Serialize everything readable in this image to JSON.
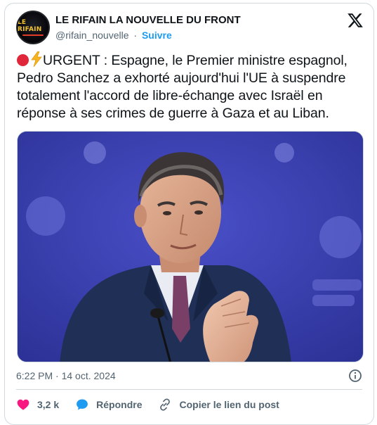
{
  "account": {
    "display_name": "LE RIFAIN LA NOUVELLE DU FRONT",
    "handle": "@rifain_nouvelle",
    "separator": "·",
    "follow_label": "Suivre",
    "avatar_text": "LE RIFAIN"
  },
  "tweet": {
    "text": "URGENT : Espagne, le Premier ministre espagnol, Pedro Sanchez a exhorté aujourd'hui l'UE à suspendre totalement l'accord de libre-échange avec Israël en réponse à ses crimes de guerre à Gaza et au Liban.",
    "timestamp": "6:22 PM · 14 oct. 2024"
  },
  "actions": {
    "like_count": "3,2 k",
    "reply_label": "Répondre",
    "copy_link_label": "Copier le lien du post"
  },
  "colors": {
    "accent": "#1d9bf0",
    "like": "#f91880",
    "reply": "#1d9bf0",
    "urgent_dot": "#e0263a",
    "media_background": "#3a3fb0"
  },
  "icons": {
    "brand": "x-logo-icon",
    "info": "info-icon",
    "like": "heart-icon",
    "reply": "speech-bubble-icon",
    "copy": "link-icon"
  }
}
